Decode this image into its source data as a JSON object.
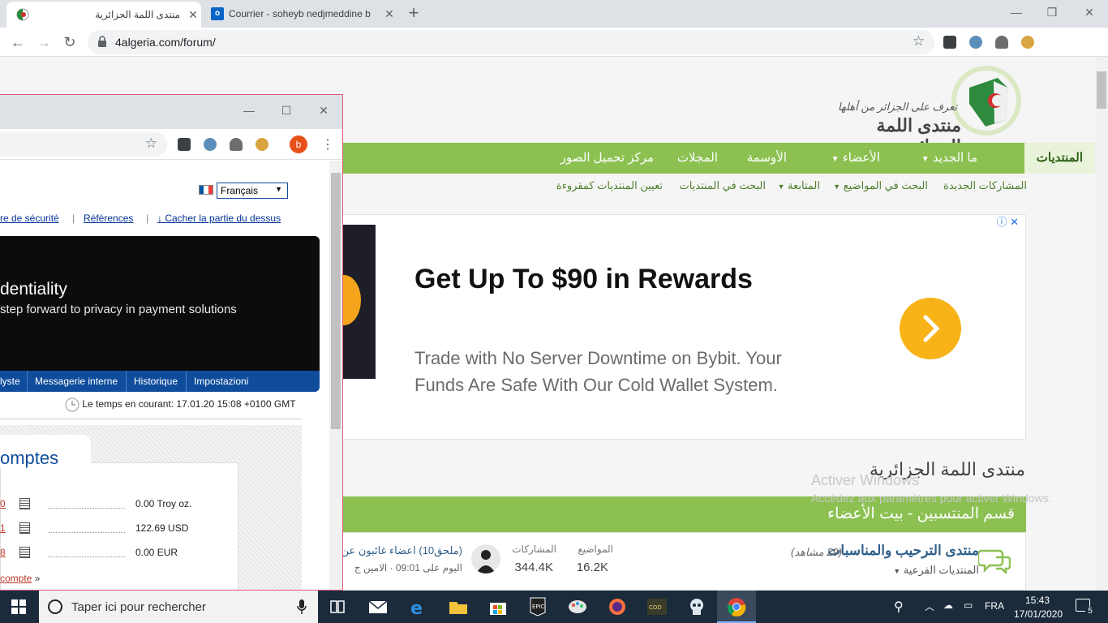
{
  "browser": {
    "tabs": [
      {
        "title": "منتدى اللمة الجزائرية",
        "active": true
      },
      {
        "title": "Courrier - soheyb nedjmeddine b",
        "active": false
      }
    ],
    "url": "4algeria.com/forum/",
    "profile_initial": "b"
  },
  "site": {
    "logo_tagline": "تعرف على الجزائر من أهلها",
    "logo_name": "منتدى اللمة الجزائرية",
    "nav": [
      "المنتديات",
      "ما الجديد",
      "الأعضاء",
      "الأوسمة",
      "المجلات",
      "مركز تحميل الصور"
    ],
    "subnav": [
      "المشاركات الجديدة",
      "البحث في المواضيع",
      "المتابعة",
      "البحث في المنتديات",
      "تعيين المنتديات كمقروءة"
    ],
    "ad": {
      "title": "Get Up To $90 in Rewards",
      "body": "Trade with No Server Downtime on Bybit. Your Funds Are Safe With Our Cold Wallet System.",
      "info_icon": "ⓘ",
      "close_icon": "✕",
      "cta_icon": "›"
    },
    "forum_title": "منتدى اللمة الجزائرية",
    "category_title": "قسم المنتسبين - بيت الأعضاء",
    "forum_row": {
      "name": "منتدى الترحيب والمناسبات",
      "viewers": "(29 مشاهد)",
      "subforums": "المنتديات الفرعية",
      "threads_label": "المواضيع",
      "threads_value": "16.2K",
      "posts_label": "المشاركات",
      "posts_value": "344.4K",
      "last_post_title": "(ملحق10) اعضاء غائبون عن",
      "last_post_meta": "اليوم على 09:01 · الامين ج"
    }
  },
  "popup": {
    "language": "Français",
    "links": [
      "re de sécurité",
      "Références",
      "↓ Cacher la partie du dessus"
    ],
    "banner_heading": "dentiality",
    "banner_sub": "step forward to privacy in payment solutions",
    "menu": [
      "lyste",
      "Messagerie interne",
      "Historique",
      "Impostazioni"
    ],
    "time_text": "Le temps en courant: 17.01.20 15:08 +0100 GMT",
    "accounts_title": "omptes",
    "accounts": [
      {
        "id": "0",
        "value": "0.00 Troy oz."
      },
      {
        "id": "1",
        "value": "122.69 USD"
      },
      {
        "id": "8",
        "value": "0.00 EUR"
      }
    ],
    "open_account": "compte",
    "open_account_suffix": "»"
  },
  "watermark": {
    "line1": "Activer Windows",
    "line2": "Accédez aux paramètres pour activer Windows."
  },
  "taskbar": {
    "search_placeholder": "Taper ici pour rechercher",
    "language": "FRA",
    "time": "15:43",
    "date": "17/01/2020",
    "notification_count": "5"
  },
  "colors": {
    "forum_green": "#8cc152",
    "popup_navy": "#0f4d9c",
    "ad_cta": "#f7b318"
  }
}
